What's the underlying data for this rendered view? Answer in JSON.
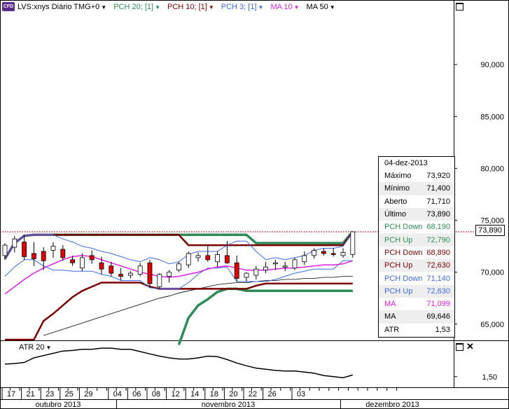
{
  "header": {
    "symbol": "LVS:xnys Diário TMG+0",
    "cfd_badge": "CFD",
    "indicators": [
      {
        "label": "PCH 20; [1]",
        "color": "#2e8b57"
      },
      {
        "label": "PCH 10; [1]",
        "color": "#7b0000"
      },
      {
        "label": "PCH 3; [1]",
        "color": "#4169e1"
      },
      {
        "label": "MA 10",
        "color": "#e020e0"
      },
      {
        "label": "MA 50",
        "color": "#000000"
      }
    ]
  },
  "price_tag": "73,890",
  "info_box": {
    "date": "04-dez-2013",
    "rows": [
      {
        "label": "Máximo",
        "value": "73,920",
        "color": "#000000"
      },
      {
        "label": "Mínimo",
        "value": "71,400",
        "color": "#000000"
      },
      {
        "label": "Aberto",
        "value": "71,710",
        "color": "#000000"
      },
      {
        "label": "Último",
        "value": "73,890",
        "color": "#000000"
      },
      {
        "label": "PCH Down",
        "value": "68,190",
        "color": "#2e8b57"
      },
      {
        "label": "PCH Up",
        "value": "72,790",
        "color": "#2e8b57"
      },
      {
        "label": "PCH Down",
        "value": "68,890",
        "color": "#7b0000"
      },
      {
        "label": "PCH Up",
        "value": "72,630",
        "color": "#7b0000"
      },
      {
        "label": "PCH Down",
        "value": "71,140",
        "color": "#4169e1"
      },
      {
        "label": "PCH Up",
        "value": "72,630",
        "color": "#4169e1"
      },
      {
        "label": "MA",
        "value": "71,099",
        "color": "#e020e0"
      },
      {
        "label": "MA",
        "value": "69,646",
        "color": "#000000"
      },
      {
        "label": "ATR",
        "value": "1,53",
        "color": "#000000"
      }
    ]
  },
  "atr_header": "ATR 20",
  "chart_data": {
    "type": "candlestick",
    "y_ticks": [
      "90,000",
      "85,000",
      "80,000",
      "75,000",
      "70,000",
      "65,000"
    ],
    "y_tick_values": [
      90,
      85,
      80,
      75,
      70,
      65
    ],
    "ylim": [
      63.5,
      95
    ],
    "last_price": 73.89,
    "x_ticks": [
      "17",
      "21",
      "23",
      "25",
      "29",
      "04",
      "06",
      "08",
      "12",
      "14",
      "18",
      "20",
      "22",
      "26",
      "03"
    ],
    "x_tick_index": [
      0,
      2,
      4,
      6,
      8,
      11,
      13,
      15,
      17,
      19,
      21,
      23,
      25,
      27,
      30
    ],
    "months": [
      {
        "label": "outubro 2013",
        "start": 0,
        "end": 10
      },
      {
        "label": "novembro 2013",
        "start": 11,
        "end": 29
      },
      {
        "label": "dezembro 2013",
        "start": 30,
        "end": 40
      }
    ],
    "candles": [
      [
        71.6,
        72.8,
        71.2,
        72.6
      ],
      [
        72.4,
        73.5,
        71.9,
        73.2
      ],
      [
        72.9,
        73.6,
        71.2,
        71.5
      ],
      [
        71.8,
        72.9,
        70.6,
        71.3
      ],
      [
        72.0,
        72.4,
        70.2,
        71.1
      ],
      [
        72.1,
        72.9,
        71.4,
        72.5
      ],
      [
        72.2,
        72.6,
        71.1,
        71.4
      ],
      [
        71.2,
        71.6,
        70.6,
        70.9
      ],
      [
        70.4,
        71.8,
        70.1,
        71.4
      ],
      [
        71.6,
        72.1,
        70.8,
        71.2
      ],
      [
        70.9,
        71.5,
        69.8,
        70.3
      ],
      [
        70.6,
        71.0,
        69.6,
        69.9
      ],
      [
        69.8,
        70.4,
        69.2,
        69.6
      ],
      [
        69.7,
        70.1,
        69.4,
        69.9
      ],
      [
        69.8,
        70.9,
        69.6,
        70.6
      ],
      [
        70.9,
        71.2,
        68.5,
        68.9
      ],
      [
        68.6,
        69.9,
        68.4,
        69.8
      ],
      [
        69.6,
        70.2,
        69.0,
        70.0
      ],
      [
        70.2,
        71.0,
        70.0,
        70.8
      ],
      [
        70.7,
        72.0,
        70.4,
        71.8
      ],
      [
        71.4,
        71.9,
        71.0,
        71.6
      ],
      [
        71.6,
        72.6,
        71.0,
        71.2
      ],
      [
        71.0,
        72.0,
        70.5,
        71.7
      ],
      [
        71.6,
        73.0,
        70.8,
        70.9
      ],
      [
        70.9,
        71.6,
        69.1,
        69.4
      ],
      [
        69.5,
        70.0,
        69.1,
        69.9
      ],
      [
        69.7,
        70.6,
        69.3,
        70.3
      ],
      [
        70.2,
        71.0,
        69.9,
        70.5
      ],
      [
        70.8,
        71.2,
        70.2,
        70.9
      ],
      [
        70.5,
        71.0,
        70.1,
        70.6
      ],
      [
        70.4,
        71.4,
        70.2,
        71.2
      ],
      [
        71.0,
        72.0,
        70.7,
        71.6
      ],
      [
        71.6,
        72.3,
        71.3,
        72.1
      ],
      [
        72.0,
        72.3,
        71.6,
        71.8
      ],
      [
        71.8,
        72.3,
        71.5,
        71.7
      ],
      [
        71.6,
        72.3,
        71.4,
        71.9
      ],
      [
        71.71,
        73.92,
        71.4,
        73.89
      ]
    ],
    "series": [
      {
        "name": "PCH 20 Up",
        "color": "#2e8b57",
        "values": [
          71.3,
          72.8,
          73.5,
          73.6,
          73.6,
          73.6,
          73.6,
          73.6,
          73.6,
          73.6,
          73.6,
          73.6,
          73.6,
          73.6,
          73.6,
          73.6,
          73.6,
          73.6,
          73.6,
          73.6,
          73.6,
          73.6,
          73.6,
          73.6,
          73.6,
          73.6,
          72.8,
          72.8,
          72.8,
          72.8,
          72.8,
          72.8,
          72.8,
          72.8,
          72.8,
          72.8,
          73.9
        ]
      },
      {
        "name": "PCH 20 Down",
        "color": "#2e8b57",
        "values": [
          null,
          null,
          null,
          null,
          null,
          null,
          null,
          null,
          null,
          null,
          null,
          null,
          null,
          null,
          null,
          null,
          null,
          null,
          63,
          65.6,
          66.8,
          67.4,
          68.1,
          68.4,
          68.4,
          68.2,
          68.2,
          68.2,
          68.2,
          68.2,
          68.2,
          68.2,
          68.2,
          68.2,
          68.2,
          68.2,
          68.2
        ]
      },
      {
        "name": "PCH 10 Up",
        "color": "#7b0000",
        "values": [
          71.3,
          72.8,
          73.5,
          73.6,
          73.6,
          73.6,
          73.6,
          73.6,
          73.6,
          73.6,
          73.6,
          73.6,
          73.6,
          73.6,
          73.6,
          73.6,
          73.6,
          73.6,
          73.6,
          72.6,
          72.6,
          72.6,
          72.6,
          72.6,
          72.6,
          72.6,
          72.6,
          72.6,
          72.6,
          72.6,
          72.6,
          72.6,
          72.6,
          72.6,
          72.6,
          72.6,
          73.9
        ]
      },
      {
        "name": "PCH 10 Down",
        "color": "#7b0000",
        "values": [
          63.5,
          63.5,
          63.5,
          63.5,
          65.3,
          66.0,
          66.8,
          67.6,
          68.2,
          68.6,
          69.0,
          69.0,
          69.0,
          69.0,
          69.0,
          68.6,
          68.4,
          68.4,
          68.4,
          68.4,
          68.4,
          68.4,
          68.4,
          68.4,
          68.4,
          68.4,
          68.7,
          68.9,
          68.9,
          68.9,
          68.9,
          68.9,
          68.9,
          68.9,
          68.9,
          68.9,
          68.9
        ]
      },
      {
        "name": "PCH 3 Up",
        "color": "#4169e1",
        "values": [
          71.3,
          72.8,
          73.5,
          73.6,
          73.6,
          73.6,
          73.2,
          72.9,
          72.5,
          72.3,
          72.0,
          71.8,
          71.5,
          71.2,
          71.0,
          71.4,
          71.2,
          70.8,
          71.0,
          71.7,
          72.0,
          72.0,
          72.0,
          72.6,
          73.0,
          73.0,
          72.0,
          71.2,
          71.4,
          71.2,
          71.4,
          71.6,
          72.1,
          72.3,
          72.3,
          72.5,
          73.9
        ]
      },
      {
        "name": "PCH 3 Down",
        "color": "#4169e1",
        "values": [
          69.6,
          70.5,
          71.2,
          71.2,
          70.6,
          70.2,
          70.2,
          70.1,
          70.1,
          70.1,
          69.8,
          69.6,
          69.2,
          69.2,
          69.2,
          68.5,
          68.4,
          68.4,
          68.4,
          69.0,
          69.8,
          70.4,
          70.4,
          70.5,
          69.1,
          69.1,
          69.1,
          69.1,
          69.3,
          69.6,
          69.9,
          70.1,
          70.3,
          70.3,
          70.3,
          71.1,
          71.1
        ]
      },
      {
        "name": "MA 10",
        "color": "#e020e0",
        "values": [
          67.9,
          68.6,
          69.3,
          69.9,
          70.4,
          70.8,
          71.2,
          71.5,
          71.6,
          71.5,
          71.2,
          70.9,
          70.6,
          70.3,
          70.0,
          69.8,
          69.6,
          69.5,
          69.6,
          69.8,
          70.0,
          70.3,
          70.5,
          70.6,
          70.4,
          70.2,
          70.2,
          70.2,
          70.3,
          70.4,
          70.4,
          70.5,
          70.6,
          70.7,
          70.7,
          70.8,
          71.1
        ]
      },
      {
        "name": "MA 50",
        "color": "#000000",
        "values": [
          null,
          null,
          null,
          null,
          63.9,
          64.2,
          64.5,
          64.8,
          65.1,
          65.4,
          65.7,
          66.0,
          66.3,
          66.6,
          66.9,
          67.2,
          67.5,
          67.7,
          68.0,
          68.2,
          68.4,
          68.6,
          68.8,
          68.9,
          69.0,
          69.0,
          69.1,
          69.2,
          69.2,
          69.3,
          69.3,
          69.4,
          69.4,
          69.5,
          69.5,
          69.6,
          69.6
        ]
      }
    ],
    "atr": {
      "ticks": [
        "1,50"
      ],
      "tick_values": [
        1.5
      ],
      "ylim": [
        1.35,
        2.1
      ],
      "values": [
        1.72,
        1.73,
        1.75,
        1.83,
        1.87,
        1.91,
        1.95,
        1.96,
        1.98,
        1.98,
        2.0,
        2.0,
        1.98,
        1.98,
        1.94,
        1.9,
        1.86,
        1.83,
        1.81,
        1.81,
        1.83,
        1.86,
        1.85,
        1.8,
        1.74,
        1.69,
        1.65,
        1.63,
        1.61,
        1.6,
        1.6,
        1.58,
        1.56,
        1.52,
        1.5,
        1.48,
        1.53
      ]
    }
  }
}
